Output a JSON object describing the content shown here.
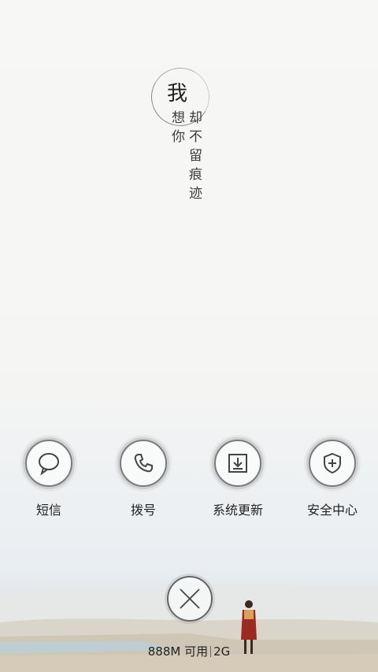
{
  "poem": {
    "wo": "我",
    "xiang": "想",
    "ni": "你",
    "que": "却",
    "bu": "不",
    "liu": "留",
    "hen": "痕",
    "ji": "迹"
  },
  "apps": [
    {
      "label": "短信",
      "icon": "message-icon"
    },
    {
      "label": "拨号",
      "icon": "phone-icon"
    },
    {
      "label": "系统更新",
      "icon": "download-icon"
    },
    {
      "label": "安全中心",
      "icon": "shield-icon"
    }
  ],
  "status": {
    "memory": "888M 可用",
    "network": "2G"
  }
}
